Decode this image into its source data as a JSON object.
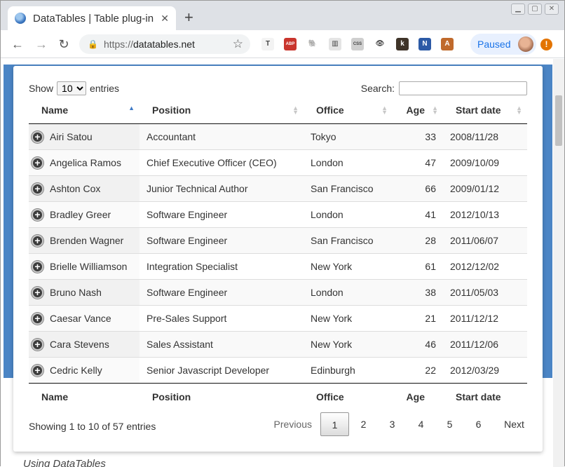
{
  "browser": {
    "tab_title": "DataTables | Table plug-in",
    "tab_close": "✕",
    "new_tab": "+",
    "url_scheme": "https://",
    "url_host": "datatables.net",
    "profile_label": "Paused",
    "extensions": [
      {
        "name": "t-extension-icon",
        "glyph": "T",
        "color": "#f3f3f3"
      },
      {
        "name": "adblock-plus-icon",
        "glyph": "ABP",
        "color": "#c9352d"
      },
      {
        "name": "evernote-icon",
        "glyph": "🐘",
        "color": "#ffffff"
      },
      {
        "name": "document-extension-icon",
        "glyph": "▥",
        "color": "#e4e4e4"
      },
      {
        "name": "css-viewer-icon",
        "glyph": "CSS",
        "color": "#cfcfcf"
      },
      {
        "name": "eye-icon",
        "glyph": "👁",
        "color": "#ffffff"
      },
      {
        "name": "k-extension-icon",
        "glyph": "k",
        "color": "#3f3429"
      },
      {
        "name": "onenote-icon",
        "glyph": "N",
        "color": "#2c5aa6"
      },
      {
        "name": "a-extension-icon",
        "glyph": "A",
        "color": "#c06a2c"
      }
    ]
  },
  "table_controls": {
    "show_label": "Show",
    "length_value": "10",
    "entries_label": "entries",
    "search_label": "Search:",
    "search_value": ""
  },
  "columns": [
    "Name",
    "Position",
    "Office",
    "Age",
    "Start date"
  ],
  "rows": [
    [
      "Airi Satou",
      "Accountant",
      "Tokyo",
      "33",
      "2008/11/28"
    ],
    [
      "Angelica Ramos",
      "Chief Executive Officer (CEO)",
      "London",
      "47",
      "2009/10/09"
    ],
    [
      "Ashton Cox",
      "Junior Technical Author",
      "San Francisco",
      "66",
      "2009/01/12"
    ],
    [
      "Bradley Greer",
      "Software Engineer",
      "London",
      "41",
      "2012/10/13"
    ],
    [
      "Brenden Wagner",
      "Software Engineer",
      "San Francisco",
      "28",
      "2011/06/07"
    ],
    [
      "Brielle Williamson",
      "Integration Specialist",
      "New York",
      "61",
      "2012/12/02"
    ],
    [
      "Bruno Nash",
      "Software Engineer",
      "London",
      "38",
      "2011/05/03"
    ],
    [
      "Caesar Vance",
      "Pre-Sales Support",
      "New York",
      "21",
      "2011/12/12"
    ],
    [
      "Cara Stevens",
      "Sales Assistant",
      "New York",
      "46",
      "2011/12/06"
    ],
    [
      "Cedric Kelly",
      "Senior Javascript Developer",
      "Edinburgh",
      "22",
      "2012/03/29"
    ]
  ],
  "info_text": "Showing 1 to 10 of 57 entries",
  "pagination": {
    "previous": "Previous",
    "pages": [
      "1",
      "2",
      "3",
      "4",
      "5",
      "6"
    ],
    "current": "1",
    "next": "Next"
  },
  "below_text": "Using DataTables",
  "colors": {
    "band": "#4b85c5",
    "sort_active": "#3e79c6",
    "paused_text": "#1a73e8"
  }
}
